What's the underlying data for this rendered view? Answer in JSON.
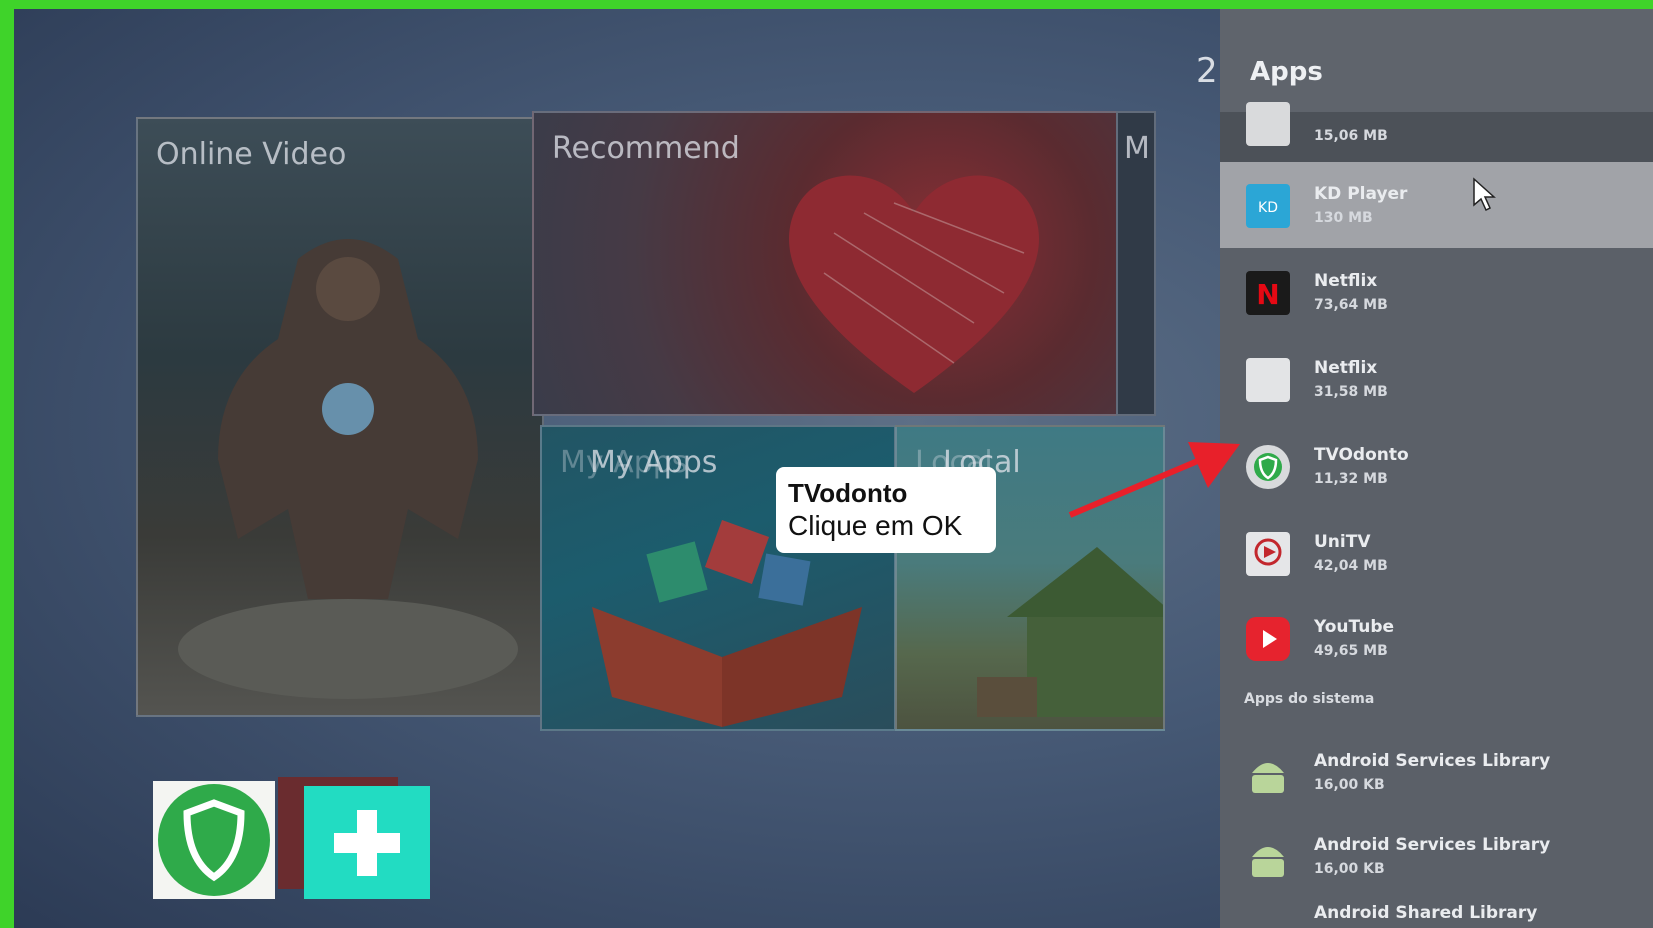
{
  "home": {
    "clock_fragment": "2",
    "tiles": {
      "online_video": "Online Video",
      "recommend": "Recommend",
      "edge_fragment": "M",
      "my_apps": "My Apps",
      "my_apps_ghost": "My Apps",
      "local": "Local",
      "local_ghost": "Local"
    }
  },
  "sidebar": {
    "title": "Apps",
    "apps": [
      {
        "name": "",
        "size": "15,06 MB",
        "icon": "generic-app-icon"
      },
      {
        "name": "KD Player",
        "size": "130 MB",
        "icon": "kd-player-icon"
      },
      {
        "name": "Netflix",
        "size": "73,64 MB",
        "icon": "netflix-icon"
      },
      {
        "name": "Netflix",
        "size": "31,58 MB",
        "icon": "netflix-alt-icon"
      },
      {
        "name": "TVOdonto",
        "size": "11,32 MB",
        "icon": "tvodonto-shield-icon"
      },
      {
        "name": "UniTV",
        "size": "42,04 MB",
        "icon": "unitv-icon"
      },
      {
        "name": "YouTube",
        "size": "49,65 MB",
        "icon": "youtube-icon"
      }
    ],
    "system_section_label": "Apps do sistema",
    "system_apps": [
      {
        "name": "Android Services Library",
        "size": "16,00 KB",
        "icon": "android-icon"
      },
      {
        "name": "Android Services Library",
        "size": "16,00 KB",
        "icon": "android-icon"
      },
      {
        "name": "Android Shared Library",
        "size": "",
        "icon": "android-icon"
      }
    ]
  },
  "tooltip": {
    "title": "TVodonto",
    "text": "Clique em OK"
  },
  "colors": {
    "frame": "#3fd32a",
    "accent_arrow": "#e8202a",
    "focus_row": "#a1a3a8",
    "add_button": "#22dcc2"
  }
}
